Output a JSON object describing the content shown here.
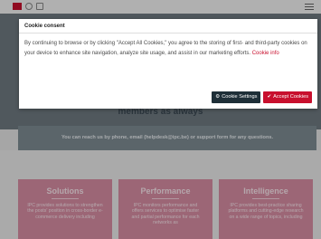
{
  "background": {
    "hero_headline": "members as always",
    "contact_text": "You can reach us by phone, email (helpdesk@ipc.be) or support form for any questions.",
    "cards": [
      {
        "title": "Solutions",
        "body": "IPC provides solutions to strengthen the posts' position in cross-border e-commerce delivery including"
      },
      {
        "title": "Performance",
        "body": "IPC monitors performance and offers services to optimise faster and partial performance for each networks as"
      },
      {
        "title": "Intelligence",
        "body": "IPC provides best-practice sharing platforms and cutting-edge research on a wide range of topics, including"
      }
    ]
  },
  "dialog": {
    "title": "Cookie consent",
    "text": "By continuing to browse or by clicking \"Accept All Cookies,\" you agree to the storing of first- and third-party cookies on your device to enhance site navigation, analyze site usage, and assist in our marketing efforts.",
    "link_text": "Cookie info",
    "settings_label": "Cookie Settings",
    "accept_label": "Accept Cookies",
    "settings_icon": "gear-icon",
    "accept_icon": "check-icon"
  },
  "colors": {
    "brand_red": "#c8102e",
    "settings_button": "#1e2f38",
    "card_pink": "#d98ea4"
  }
}
